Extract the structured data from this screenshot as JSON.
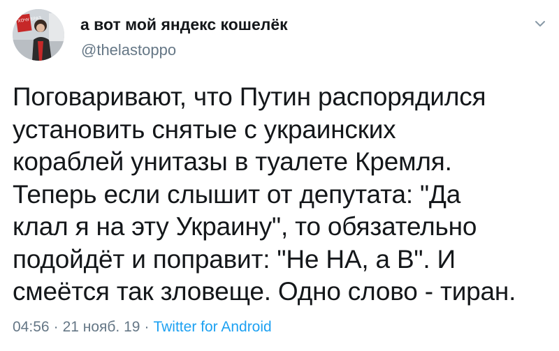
{
  "author": {
    "name": "а вот мой яндекс кошелёк",
    "handle": "@thelastoppo",
    "avatar_sign_text": "ХОЧУ ЕРАЗ"
  },
  "menu": {
    "icon": "chevron-down-icon"
  },
  "tweet": {
    "lines": [
      "Поговаривают, что Путин распорядился",
      "установить снятые с украинских",
      "кораблей унитазы в туалете Кремля.",
      "Теперь если слышит от депутата: \"Да",
      "клал я на эту Украину\", то обязательно",
      "подойдёт и поправит: \"Не НА, а В\". И",
      "смеётся так зловеще. Одно слово - тиран."
    ]
  },
  "meta": {
    "time": "04:56",
    "date": "21 нояб. 19",
    "separator": "·",
    "source": "Twitter for Android"
  },
  "colors": {
    "text": "#14171a",
    "secondary": "#657786",
    "link": "#1da1f2"
  }
}
